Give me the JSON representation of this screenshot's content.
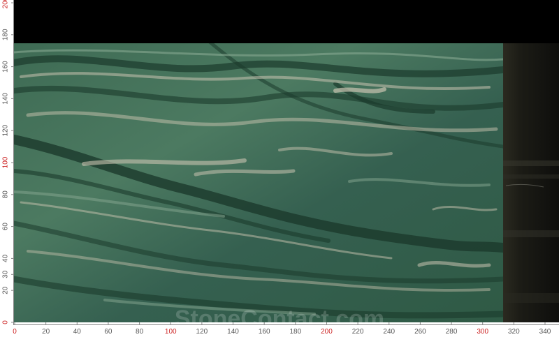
{
  "ruler": {
    "x_labels": [
      "0",
      "20",
      "40",
      "60",
      "80",
      "100",
      "120",
      "140",
      "160",
      "180",
      "200",
      "220",
      "240",
      "260",
      "280",
      "300",
      "320",
      "340"
    ],
    "y_labels": [
      "0",
      "20",
      "30",
      "40",
      "60",
      "80",
      "100",
      "120",
      "140",
      "160",
      "180",
      "200"
    ],
    "label_color": "#555555",
    "highlight_color": "#cc2222",
    "highlight_labels": [
      "0",
      "100",
      "200",
      "300"
    ]
  },
  "photo": {
    "subject": "green marble slab",
    "slab_colors": [
      "#2f5a45",
      "#3d6b52",
      "#87a891",
      "#c9c3b0",
      "#1b3a2c"
    ],
    "backdrop_color": "#000000"
  },
  "watermark": {
    "text": "StoneContact.com"
  }
}
